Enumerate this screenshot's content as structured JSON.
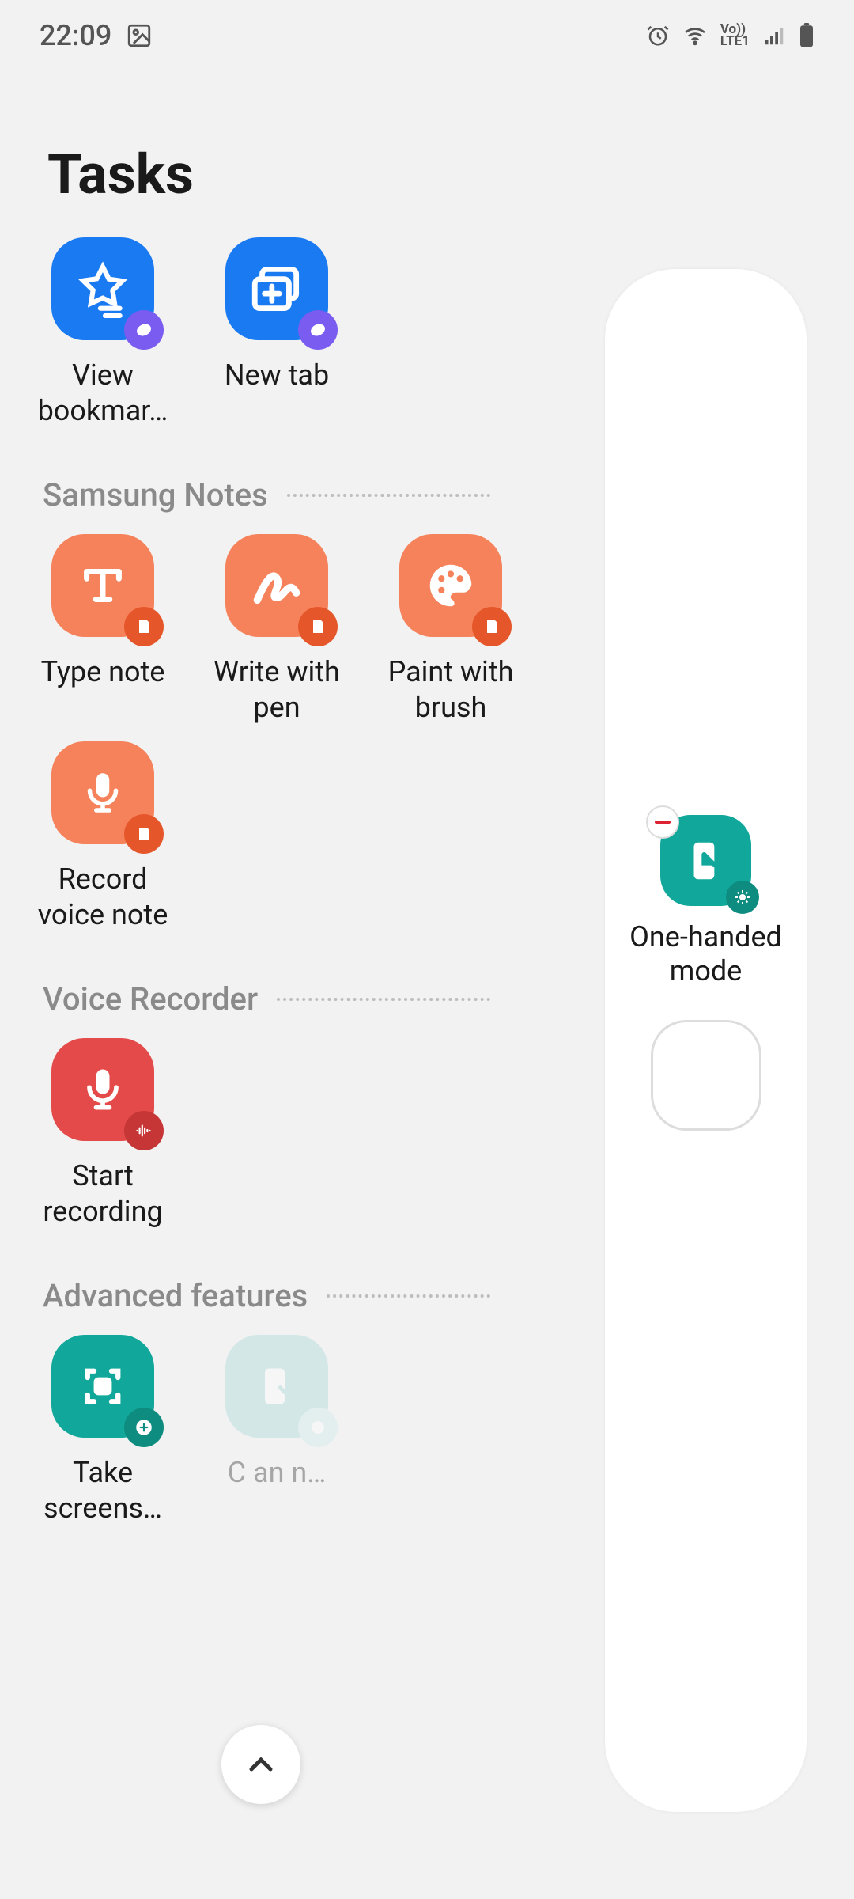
{
  "statusbar": {
    "time": "22:09"
  },
  "header": {
    "title": "Tasks"
  },
  "browser_tasks": [
    {
      "id": "view-bookmarks",
      "label": "View bookmar…"
    },
    {
      "id": "new-tab",
      "label": "New tab"
    }
  ],
  "sections": [
    {
      "id": "samsung-notes",
      "title": "Samsung Notes",
      "tasks": [
        {
          "id": "type-note",
          "label": "Type note"
        },
        {
          "id": "write-with-pen",
          "label": "Write with pen"
        },
        {
          "id": "paint-with-brush",
          "label": "Paint with brush"
        },
        {
          "id": "record-voice-note",
          "label": "Record voice note"
        }
      ]
    },
    {
      "id": "voice-recorder",
      "title": "Voice Recorder",
      "tasks": [
        {
          "id": "start-recording",
          "label": "Start recording"
        }
      ]
    },
    {
      "id": "advanced-features",
      "title": "Advanced features",
      "tasks": [
        {
          "id": "take-screenshot",
          "label": "Take screens…"
        },
        {
          "id": "one-handed-secondary",
          "label": "C​ an​ n…"
        }
      ]
    }
  ],
  "sidepanel": {
    "items": [
      {
        "id": "one-handed-mode",
        "label": "One-handed mode"
      }
    ]
  },
  "colors": {
    "blue": "#1a7af2",
    "orange": "#f5825a",
    "orange_badge": "#e5572a",
    "red": "#e44a4a",
    "teal": "#11a89b",
    "purple": "#7b5cf0",
    "teal_light": "#9bd4d5"
  }
}
